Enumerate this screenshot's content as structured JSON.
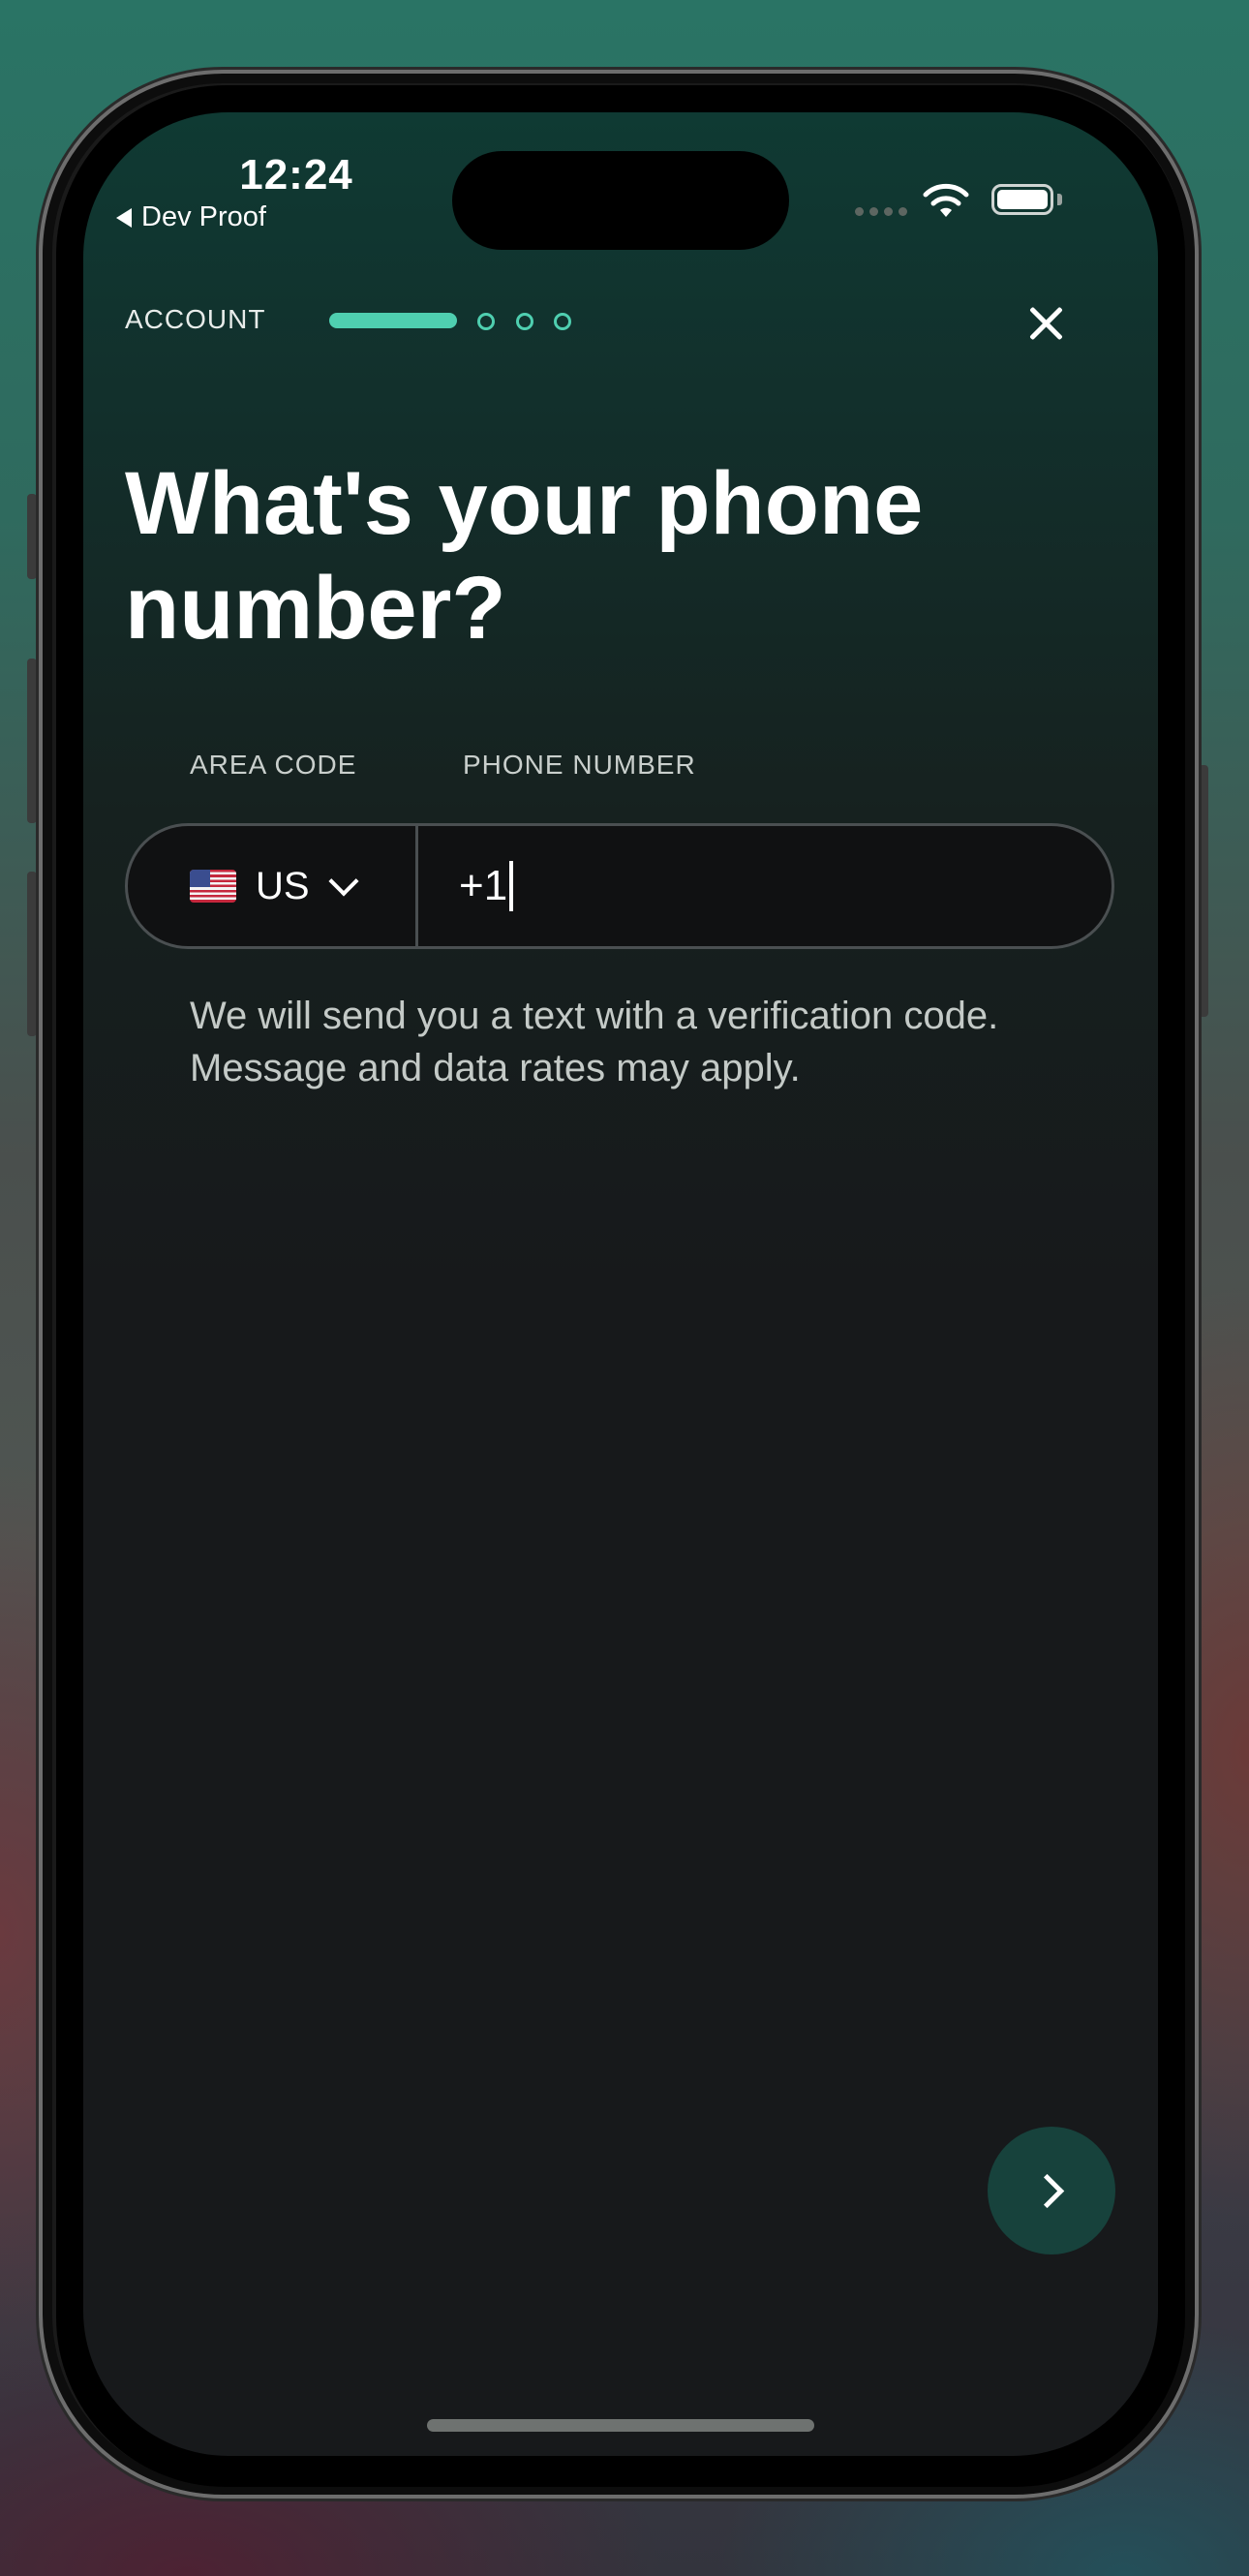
{
  "status_bar": {
    "time": "12:24",
    "back_app": "Dev Proof",
    "icons": [
      "signal-icon",
      "wifi-icon",
      "battery-icon"
    ]
  },
  "header": {
    "step_label": "ACCOUNT",
    "progress": {
      "current_step": 1,
      "total_steps": 4
    },
    "close_icon": "close-icon"
  },
  "main": {
    "title": "What's your phone number?",
    "area_code_label": "AREA CODE",
    "phone_number_label": "PHONE NUMBER",
    "country_code": "US",
    "phone_value": "+1",
    "helper_text": "We will send you a text with a verification code. Message and data rates may apply."
  },
  "footer": {
    "next_icon": "chevron-right-icon"
  },
  "colors": {
    "accent": "#4fcfb0",
    "background": "#17191b",
    "next_button": "#17423c"
  }
}
